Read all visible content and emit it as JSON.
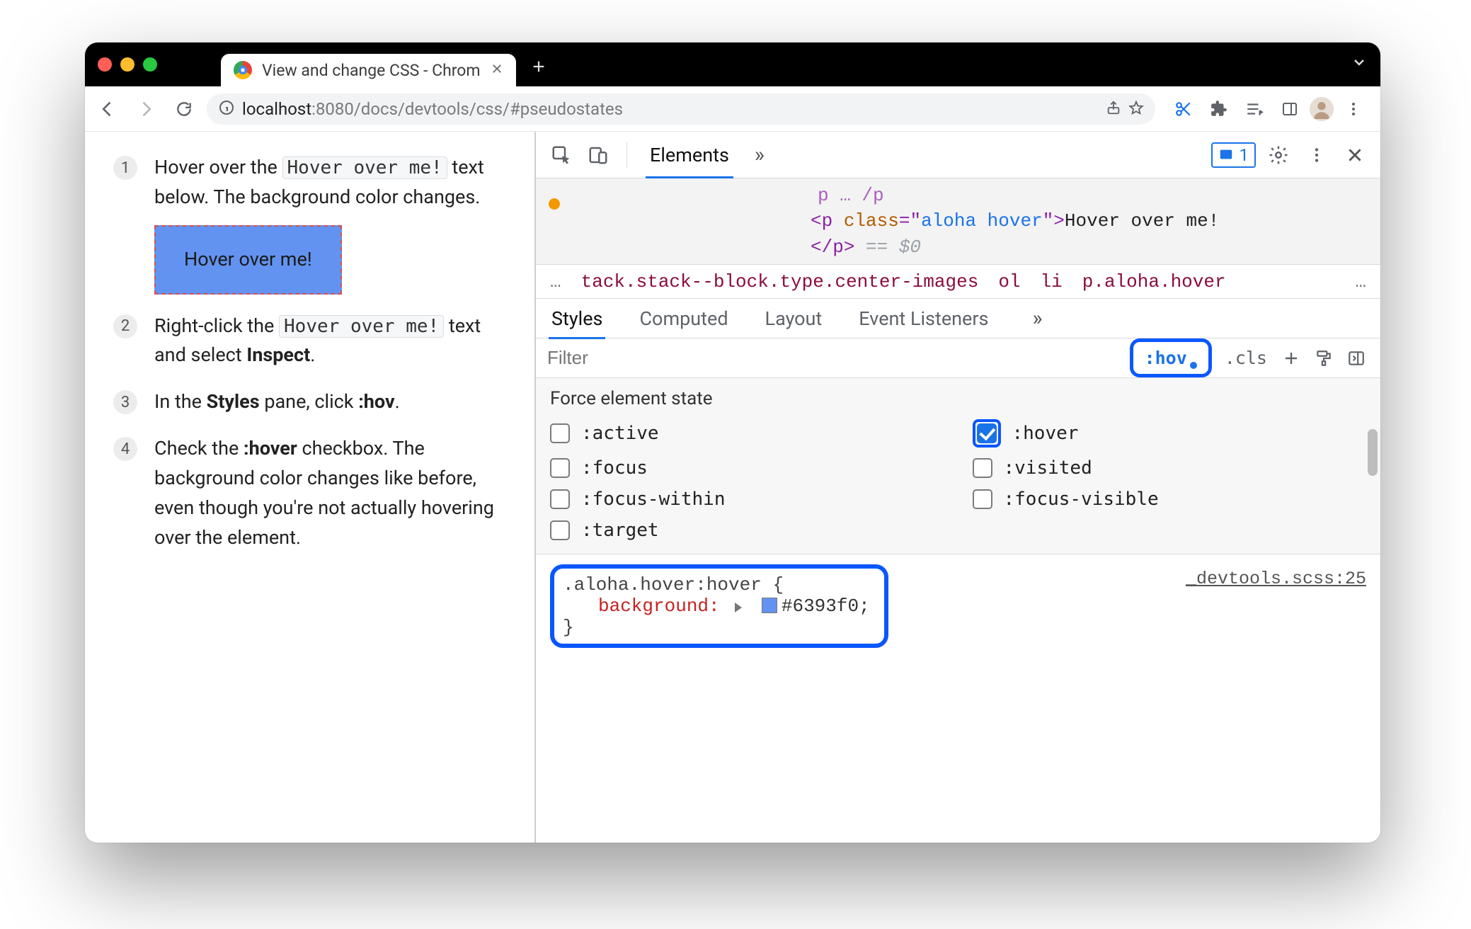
{
  "browser": {
    "tab_title": "View and change CSS - Chrom",
    "url": {
      "host": "localhost",
      "port": ":8080",
      "path": "/docs/devtools/css/#pseudostates"
    }
  },
  "page": {
    "steps": [
      {
        "n": "1",
        "pre": "Hover over the ",
        "code": "Hover over me!",
        "post": " text below. The background color changes."
      },
      {
        "n": "2",
        "pre": "Right-click the ",
        "code": "Hover over me!",
        "post": " text and select ",
        "bold": "Inspect",
        "post2": "."
      },
      {
        "n": "3",
        "pre": "In the ",
        "bold": "Styles",
        "post": " pane, click ",
        "bold2": ":hov",
        "post2": "."
      },
      {
        "n": "4",
        "pre": "Check the ",
        "bold": ":hover",
        "post": " checkbox. The background color changes like before, even though you're not actually hovering over the element."
      }
    ],
    "demo_label": "Hover over me!"
  },
  "devtools": {
    "tabs": {
      "active": "Elements"
    },
    "issues_count": "1",
    "dom": {
      "open_tag_pre": "<p ",
      "attr_name": "class",
      "attr_val": "aloha hover",
      "text": "Hover over me!",
      "close_tag": "</p>",
      "eq0": " == $0"
    },
    "breadcrumb": {
      "ellipsis": "…",
      "long": "tack.stack--block.type.center-images",
      "ol": "ol",
      "li": "li",
      "sel": "p.aloha.hover"
    },
    "styles_tabs": [
      "Styles",
      "Computed",
      "Layout",
      "Event Listeners"
    ],
    "filter_placeholder": "Filter",
    "hov_label": ":hov",
    "cls_label": ".cls",
    "force_title": "Force element state",
    "pseudo": {
      "active": ":active",
      "hover": ":hover",
      "focus": ":focus",
      "visited": ":visited",
      "focus_within": ":focus-within",
      "focus_visible": ":focus-visible",
      "target": ":target"
    },
    "rule": {
      "selector": ".aloha.hover:hover {",
      "prop": "background",
      "value": "#6393f0",
      "close": "}",
      "source": "_devtools.scss:25"
    }
  }
}
